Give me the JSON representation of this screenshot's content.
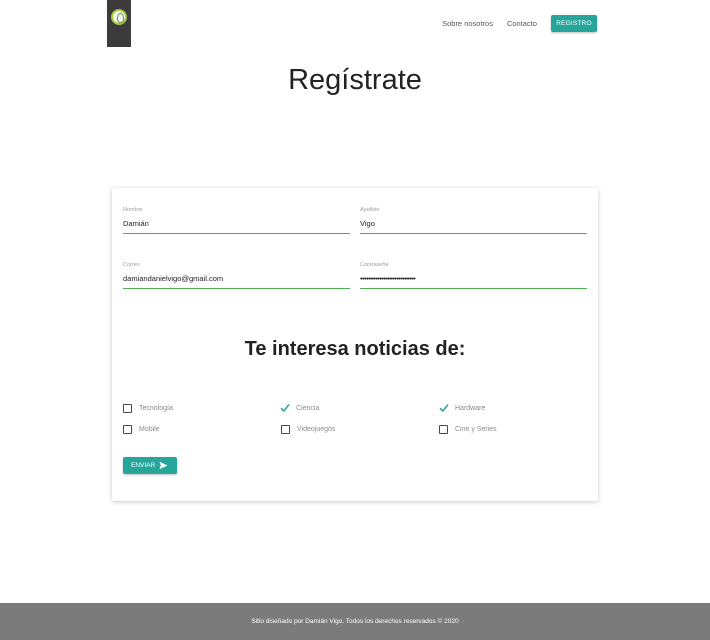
{
  "header": {
    "logo_alt": "logo",
    "nav": {
      "about": "Sobre nosotros",
      "contact": "Contacto",
      "register": "REGISTRO"
    }
  },
  "page": {
    "title": "Regístrate"
  },
  "form": {
    "fields": [
      {
        "label": "Nombre",
        "value": "Damián"
      },
      {
        "label": "Apellido",
        "value": "Vigo"
      },
      {
        "label": "Correo",
        "value": "damiandanielvigo@gmail.com"
      },
      {
        "label": "Contraseña",
        "value": "••••••••••••••••••••••••••"
      }
    ],
    "interests_title": "Te interesa noticias de:",
    "interests": [
      {
        "label": "Tecnología",
        "checked": false
      },
      {
        "label": "Ciencia",
        "checked": true
      },
      {
        "label": "Hardware",
        "checked": true
      },
      {
        "label": "Mobile",
        "checked": false
      },
      {
        "label": "Videojuegos",
        "checked": false
      },
      {
        "label": "Cine y Series",
        "checked": false
      }
    ],
    "submit_label": "ENVIAR"
  },
  "footer": {
    "text": "Sitio diseñado por Damián Vigo. Todos los derechos reservados © 2020"
  },
  "colors": {
    "accent": "#26a69a",
    "field_line": "#4caf50",
    "footer_bg": "#7b7b7b",
    "logo_bg": "#3b3b3b"
  }
}
